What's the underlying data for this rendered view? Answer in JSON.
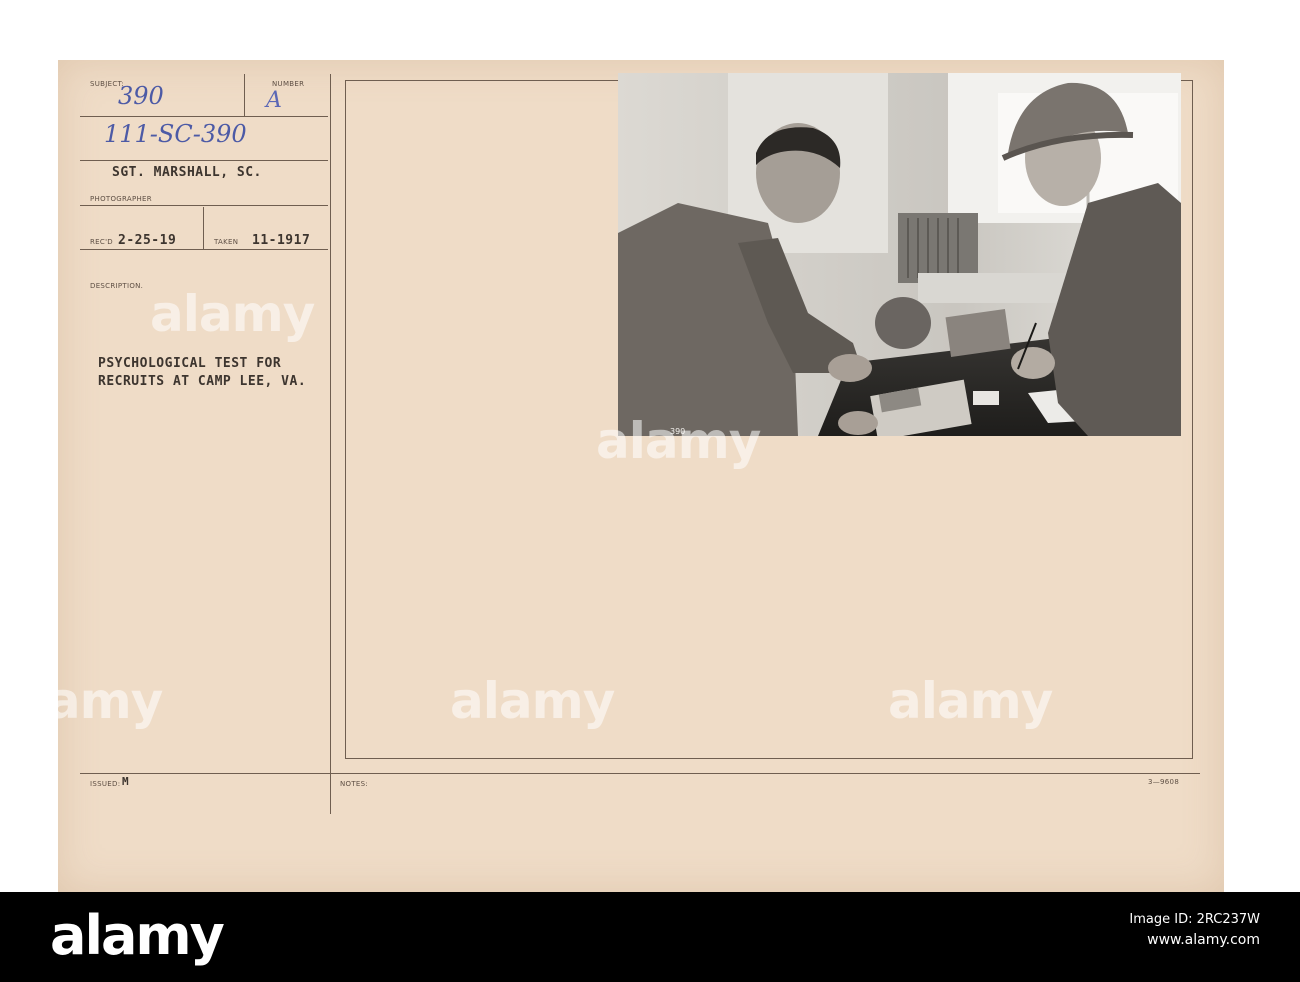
{
  "card": {
    "subject_label": "SUBJECT:",
    "subject_value": "390",
    "number_label": "NUMBER",
    "number_value": "A",
    "catalog_number": "111-SC-390",
    "photographer_name": "SGT. MARSHALL, SC.",
    "photographer_label": "PHOTOGRAPHER",
    "received_label": "REC'D",
    "received_value": "2-25-19",
    "taken_label": "TAKEN",
    "taken_value": "11-1917",
    "description_label": "DESCRIPTION.",
    "description_line1": "PSYCHOLOGICAL TEST FOR",
    "description_line2": "RECRUITS AT CAMP LEE, VA.",
    "issued_label": "ISSUED:",
    "issued_value": "M",
    "notes_label": "NOTES:",
    "form_number": "3—9608",
    "photo_number": "390"
  },
  "watermarks": [
    "alamy",
    "alamy",
    "alamy",
    "alamy",
    "alamy"
  ],
  "footer": {
    "logo": "alamy",
    "image_id_label": "Image ID: 2RC237W",
    "url": "www.alamy.com"
  },
  "colors": {
    "card": "#efdcc7",
    "ink_blue": "#4c5aa6",
    "type_ink": "#3d352f",
    "footer_bg": "#000000"
  }
}
